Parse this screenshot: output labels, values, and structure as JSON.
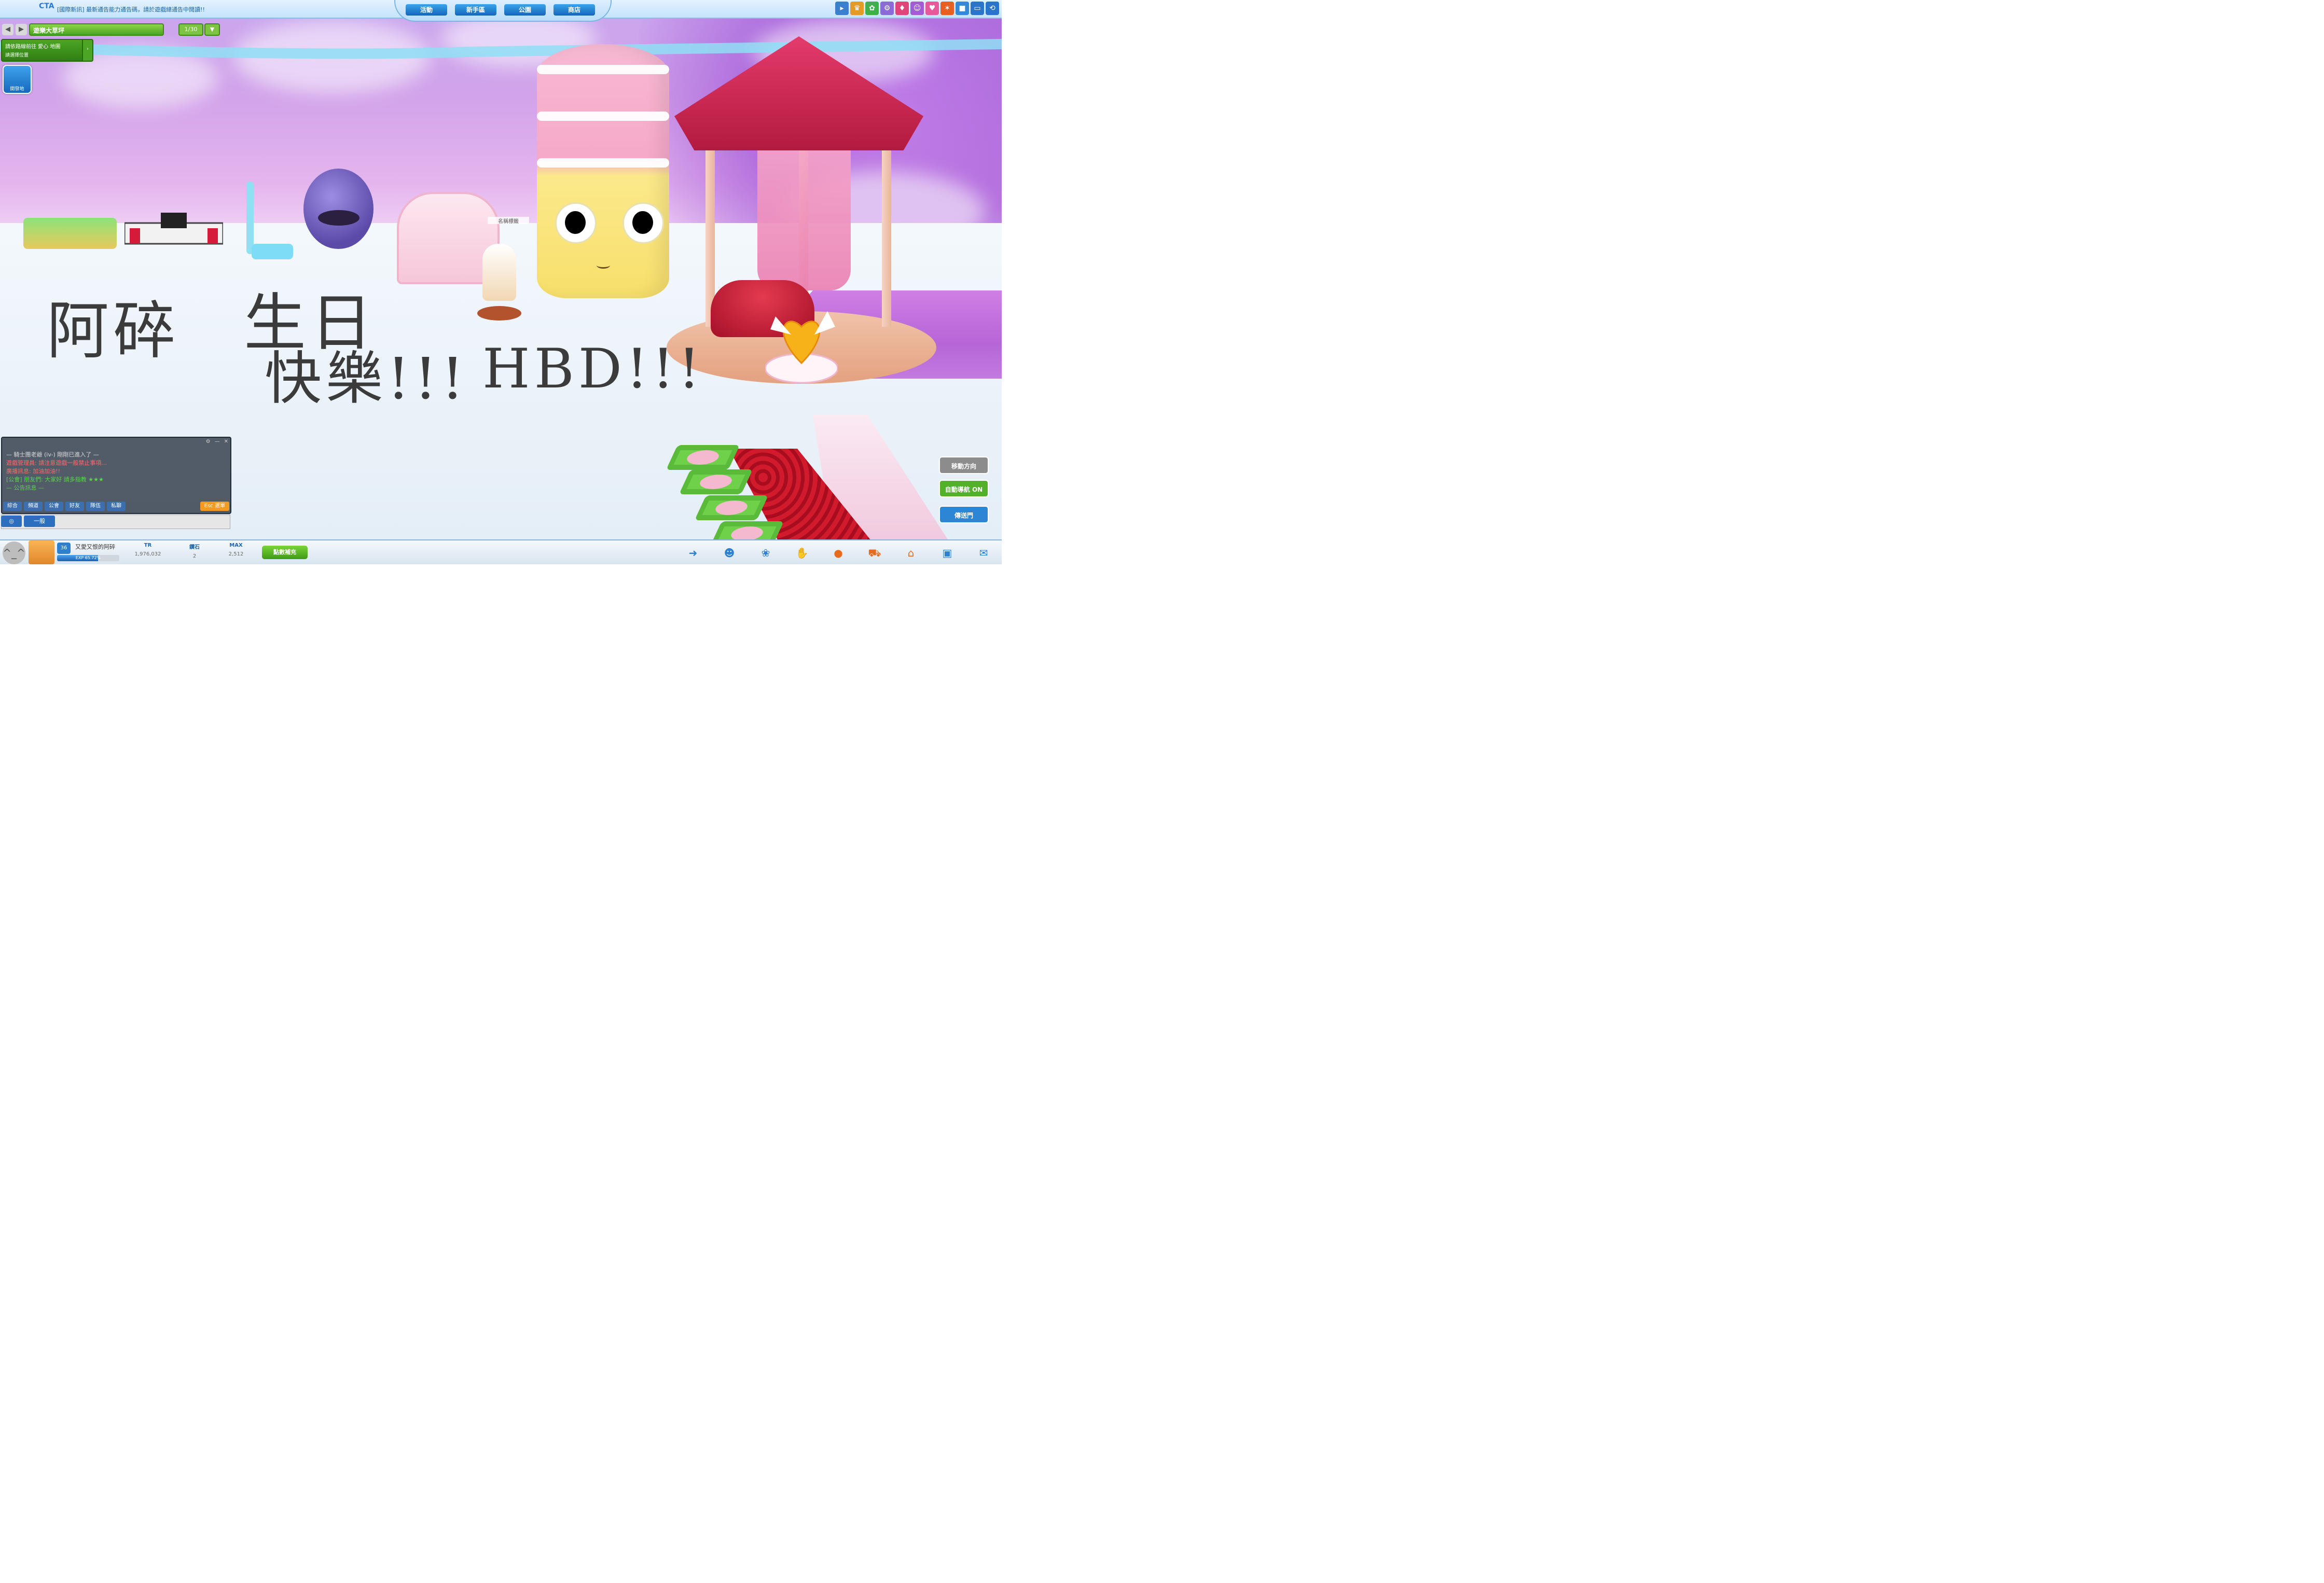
{
  "topbar": {
    "logo": "CTA",
    "notice": "[國際新訊] 最新通告能力通告碼，請於遊戲總通告中閱讀!!",
    "tabs": [
      "活動",
      "新手區",
      "公園",
      "商店"
    ],
    "icons": [
      "arrow-icon",
      "trophy-icon",
      "gift-icon",
      "gear-icon",
      "shop-icon",
      "pet-icon",
      "heart-icon",
      "flame-icon",
      "gift-box-icon",
      "window-icon",
      "back-icon"
    ]
  },
  "location": {
    "back_label": "◀",
    "forward_label": "▶",
    "name": "遊樂大草坪",
    "count": "1/30",
    "arrow_label": "▼"
  },
  "quest": {
    "line1": "請依路線前往 愛心 地圖",
    "line2": "請選擇位置",
    "side_label": "›"
  },
  "map_button": {
    "label": "開發地"
  },
  "handwriting": {
    "line1": "阿碎",
    "line2": "生日",
    "line3": "快樂!!!",
    "line4": "HBD!!!"
  },
  "avatar_tag": "名稱標籤",
  "chat": {
    "header_icons": [
      "settings-icon",
      "minimize-icon",
      "close-icon"
    ],
    "lines": [
      {
        "text": "— 騎士團老爺 (iv-) 剛剛已進入了 —",
        "color": "#dadada"
      },
      {
        "text": "遊戲管理員: 請注意遊戲一般禁止事項…",
        "color": "#ff6a6a"
      },
      {
        "text": "廣播訊息: 加油加油!!",
        "color": "#ff6a6a"
      },
      {
        "text": "[公會] 朋友們: 大家好 請多指教 ★★★",
        "color": "#5bd54a"
      },
      {
        "text": "— 公告訊息 —",
        "color": "#5bd54a"
      }
    ],
    "tabs": [
      "綜合",
      "頻道",
      "公會",
      "好友",
      "隊伍",
      "私聊"
    ],
    "orange_tab": "Esc 選單",
    "select_label": "◎",
    "mode_label": "一般"
  },
  "right_buttons": [
    {
      "label": "移動方向",
      "color": "#8c8c8c"
    },
    {
      "label": "自動導航 ON",
      "color": "#52b128"
    },
    {
      "label": "傳送門",
      "color": "#2d85d6"
    }
  ],
  "bottombar": {
    "face_label": "^_^",
    "level": "36",
    "name": "又愛又恨的阿碎",
    "exp_text": "EXP 65.72%",
    "exp_fraction": 0.6572,
    "stats": [
      {
        "key": "TR",
        "value": "1,976,032"
      },
      {
        "key": "鑽石",
        "value": "2"
      },
      {
        "key": "MAX",
        "value": "2,512"
      }
    ],
    "green_button": "點數補充",
    "icons": [
      "help-icon",
      "friends-icon",
      "pet-paw-icon",
      "handshake-icon",
      "food-icon",
      "cart-icon",
      "home-icon",
      "bag-icon",
      "chat-bubble-icon"
    ]
  },
  "colors": {
    "accent": "#1b79d6",
    "green": "#4ea320",
    "topbar_bg": "#c5e3fb",
    "chat_bg": "#303a48"
  }
}
